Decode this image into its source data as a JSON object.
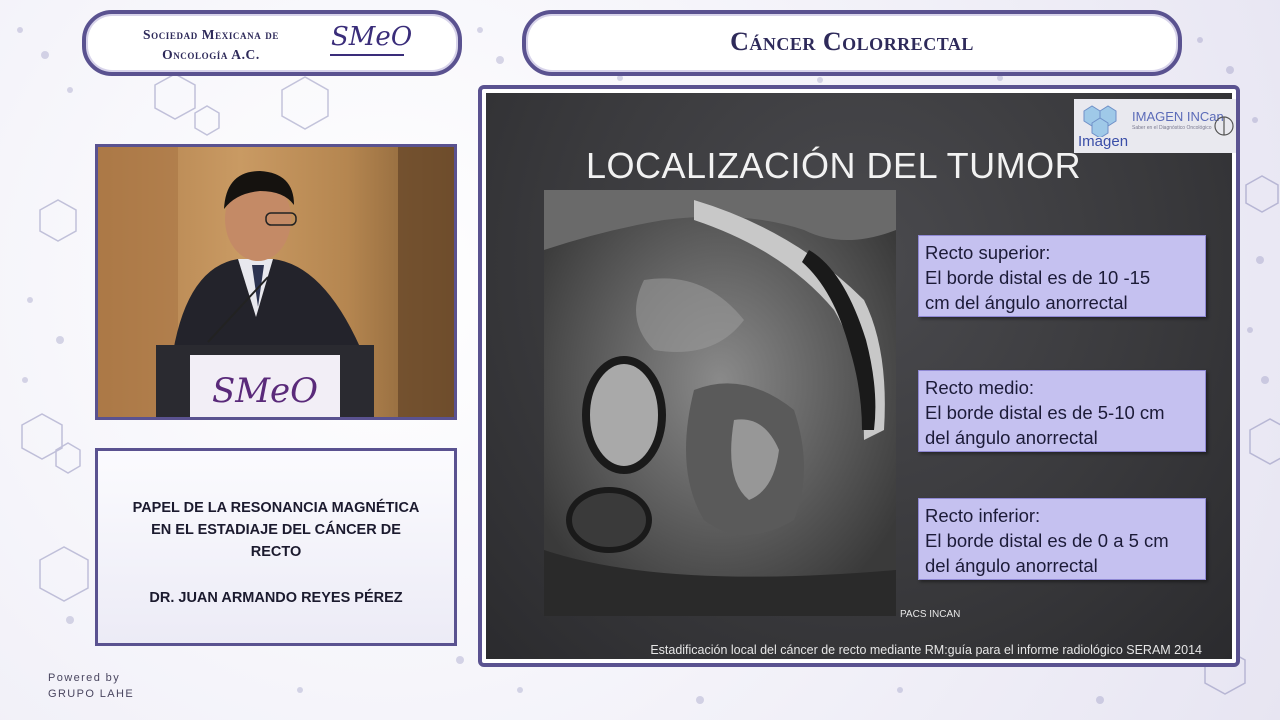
{
  "header": {
    "org_name_line1": "Sociedad Mexicana de",
    "org_name_line2": "Oncología A.C.",
    "org_logo_text": "SMeO",
    "course_title": "Cáncer Colorrectal"
  },
  "video": {
    "podium_logo": "SMeO"
  },
  "info": {
    "talk_title_line1": "PAPEL DE LA RESONANCIA MAGNÉTICA",
    "talk_title_line2": "EN EL ESTADIAJE DEL CÁNCER DE",
    "talk_title_line3": "RECTO",
    "speaker": "DR. JUAN ARMANDO REYES PÉREZ"
  },
  "footer": {
    "powered_line1": "Powered by",
    "powered_line2": "GRUPO LAHE"
  },
  "slide": {
    "heading": "LOCALIZACIÓN DEL TUMOR",
    "logo_text": "IMAGEN INCan",
    "logo_subtext": "Saber en el Diagnóstico Oncológico",
    "logo_word": "Imagen",
    "cards": [
      {
        "title": "Recto superior:",
        "line1": "El borde distal es de 10 -15",
        "line2": "cm del ángulo anorrectal"
      },
      {
        "title": "Recto medio:",
        "line1": "El borde distal es de 5-10 cm",
        "line2": "del ángulo anorrectal"
      },
      {
        "title": "Recto inferior:",
        "line1": "El borde distal es de 0 a 5 cm",
        "line2": "del ángulo anorrectal"
      }
    ],
    "image_credit": "PACS INCAN",
    "citation": "Estadificación local del cáncer de recto mediante RM:guía para el informe radiológico SERAM 2014"
  },
  "colors": {
    "frame_purple": "#5a5290",
    "card_fill": "#c5c1f0",
    "slide_bg": "#3a3a3d"
  }
}
